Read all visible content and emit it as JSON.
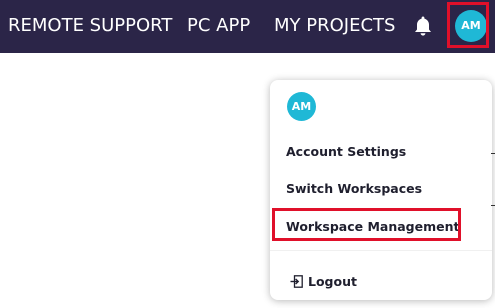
{
  "colors": {
    "nav_bg": "#2b2548",
    "avatar_bg": "#1fb8d6",
    "highlight": "#e0102a"
  },
  "nav": {
    "items": [
      {
        "label": "REMOTE SUPPORT"
      },
      {
        "label": "PC APP"
      },
      {
        "label": "MY PROJECTS"
      }
    ],
    "notification_icon": "bell-icon",
    "user_initials": "AM"
  },
  "dropdown": {
    "user_initials": "AM",
    "items": [
      {
        "label": "Account Settings"
      },
      {
        "label": "Switch Workspaces"
      },
      {
        "label": "Workspace Management"
      }
    ],
    "logout_label": "Logout",
    "logout_icon": "sign-out-icon"
  }
}
